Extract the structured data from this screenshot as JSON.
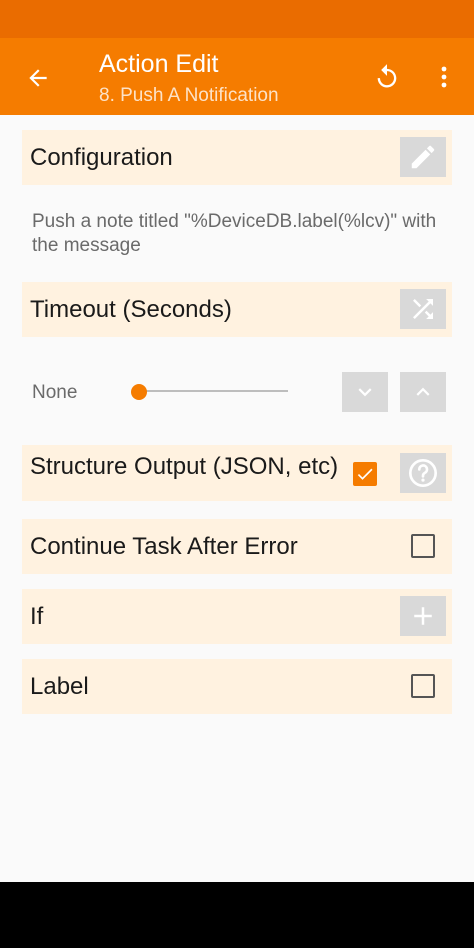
{
  "appbar": {
    "title": "Action Edit",
    "subtitle": "8. Push A Notification",
    "back_icon": "arrow-left-icon",
    "reset_icon": "reset-icon",
    "more_icon": "more-vertical-icon"
  },
  "configuration": {
    "label": "Configuration",
    "icon": "pencil-icon",
    "description": "Push a note titled \"%DeviceDB.label(%lcv)\" with the message"
  },
  "timeout": {
    "label": "Timeout (Seconds)",
    "icon": "shuffle-icon",
    "value_label": "None",
    "slider_fraction": 0.0
  },
  "structure_output": {
    "label": "Structure Output (JSON, etc)",
    "checked": true,
    "icon": "help-icon"
  },
  "continue_after_error": {
    "label": "Continue Task After Error",
    "checked": false
  },
  "if_condition": {
    "label": "If",
    "icon": "plus-icon"
  },
  "label_field": {
    "label": "Label",
    "checked": false
  },
  "colors": {
    "accent": "#f57c00",
    "statusbar": "#ea6c00",
    "row_bg": "#fff2e0",
    "icon_btn_bg": "#d9d9d9"
  }
}
